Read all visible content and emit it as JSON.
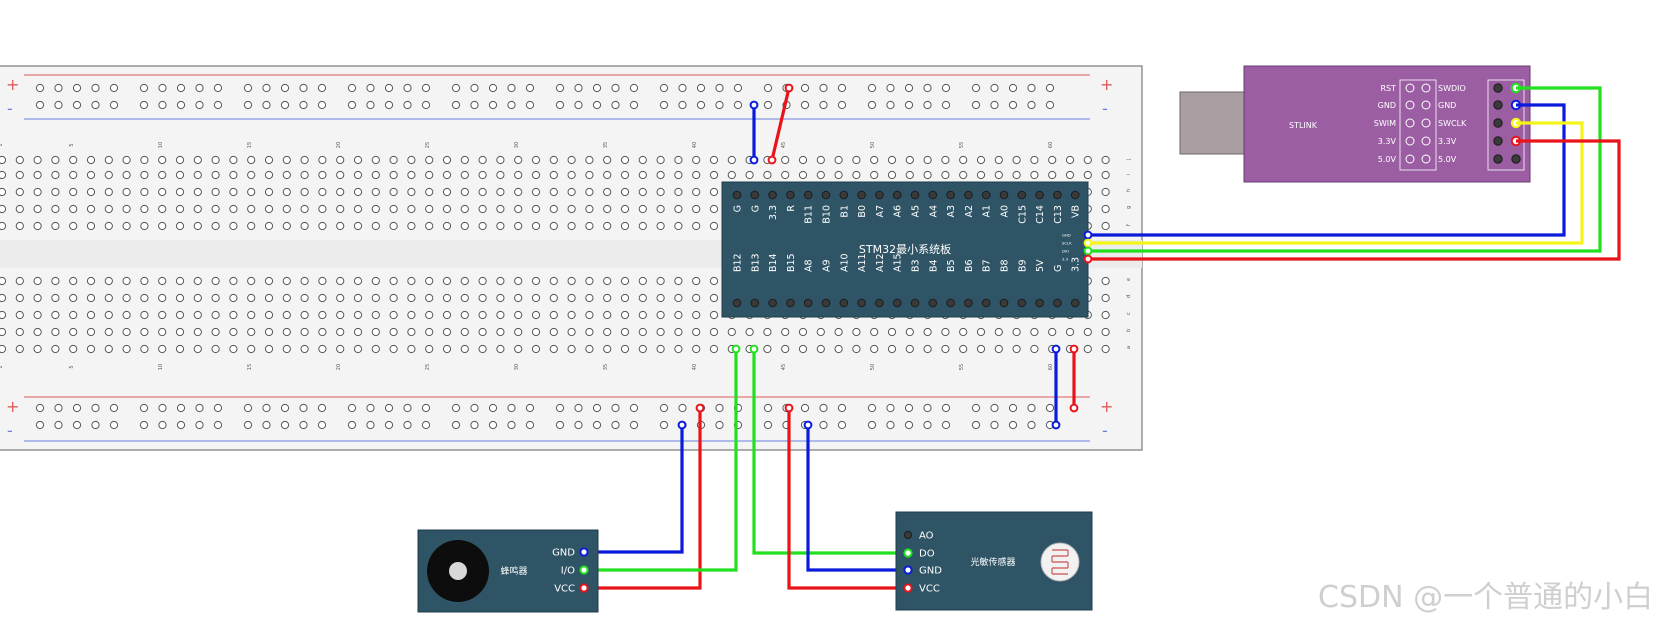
{
  "breadboard": {
    "plus_sign": "+",
    "minus_sign": "-",
    "column_numbers": [
      "1",
      "5",
      "10",
      "15",
      "20",
      "25",
      "30",
      "35",
      "40",
      "45",
      "50",
      "55",
      "60"
    ],
    "row_letters_top": [
      "j",
      "i",
      "h",
      "g",
      "f"
    ],
    "row_letters_bottom": [
      "e",
      "d",
      "c",
      "b",
      "a"
    ]
  },
  "mcu": {
    "title": "STM32最小系统板",
    "top_pins": [
      "G",
      "G",
      "3.3",
      "R",
      "B11",
      "B10",
      "B1",
      "B0",
      "A7",
      "A6",
      "A5",
      "A4",
      "A3",
      "A2",
      "A1",
      "A0",
      "C15",
      "C14",
      "C13",
      "VB"
    ],
    "bottom_pins": [
      "B12",
      "B13",
      "B14",
      "B15",
      "A8",
      "A9",
      "A10",
      "A11",
      "A12",
      "A15",
      "B3",
      "B4",
      "B5",
      "B6",
      "B7",
      "B8",
      "B9",
      "5V",
      "G",
      "3.3"
    ],
    "side_pins": [
      "GND",
      "SCLK",
      "DIO",
      "3.3"
    ]
  },
  "stlink": {
    "title": "STLINK",
    "left_labels": [
      "RST",
      "GND",
      "SWIM",
      "3.3V",
      "5.0V"
    ],
    "right_labels": [
      "SWDIO",
      "GND",
      "SWCLK",
      "3.3V",
      "5.0V"
    ]
  },
  "buzzer": {
    "title": "蜂鸣器",
    "pins": [
      "GND",
      "I/O",
      "VCC"
    ]
  },
  "light_sensor": {
    "title": "光敏传感器",
    "pins": [
      "AO",
      "DO",
      "GND",
      "VCC"
    ]
  },
  "watermark": "CSDN @一个普通的小白",
  "colors": {
    "board": "#f2f2f2",
    "mcu": "#2e5466",
    "stlink": "#9b5ea3",
    "module": "#2e5466",
    "wire_gnd": "#0a1bdc",
    "wire_power": "#e8141a",
    "wire_signal": "#22e01f",
    "wire_clock": "#f4f41a",
    "rail_red": "#e05a5a",
    "rail_blue": "#6a7ee0"
  }
}
